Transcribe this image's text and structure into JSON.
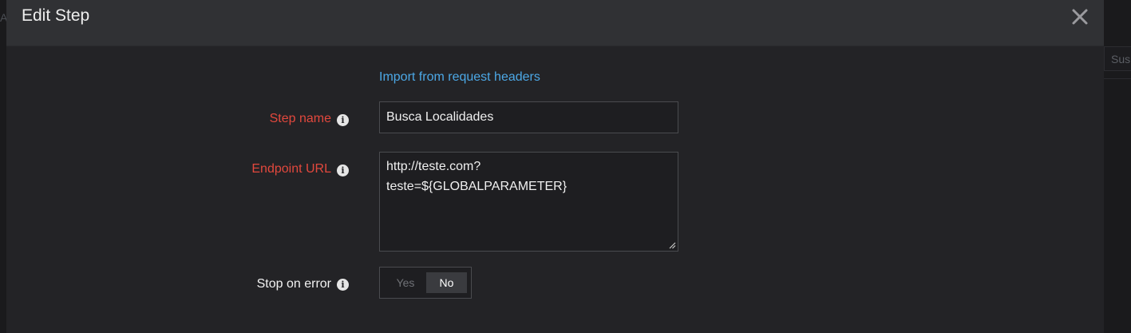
{
  "background": {
    "right_field_text": "Susp",
    "left_edge_text": "A"
  },
  "modal": {
    "title": "Edit Step",
    "close_icon": "close-icon",
    "import_link": "Import from request headers",
    "fields": {
      "step_name": {
        "label": "Step name",
        "required": true,
        "info_icon": "info-icon",
        "value": "Busca Localidades"
      },
      "endpoint_url": {
        "label": "Endpoint URL",
        "required": true,
        "info_icon": "info-icon",
        "value": "http://teste.com?\nteste=${GLOBALPARAMETER}"
      },
      "stop_on_error": {
        "label": "Stop on error",
        "required": false,
        "info_icon": "info-icon",
        "options": [
          "Yes",
          "No"
        ],
        "selected": "No"
      }
    }
  },
  "colors": {
    "required_label": "#e2483d",
    "link": "#4ca8e6",
    "header_bg": "#303134",
    "body_bg": "#232326"
  }
}
